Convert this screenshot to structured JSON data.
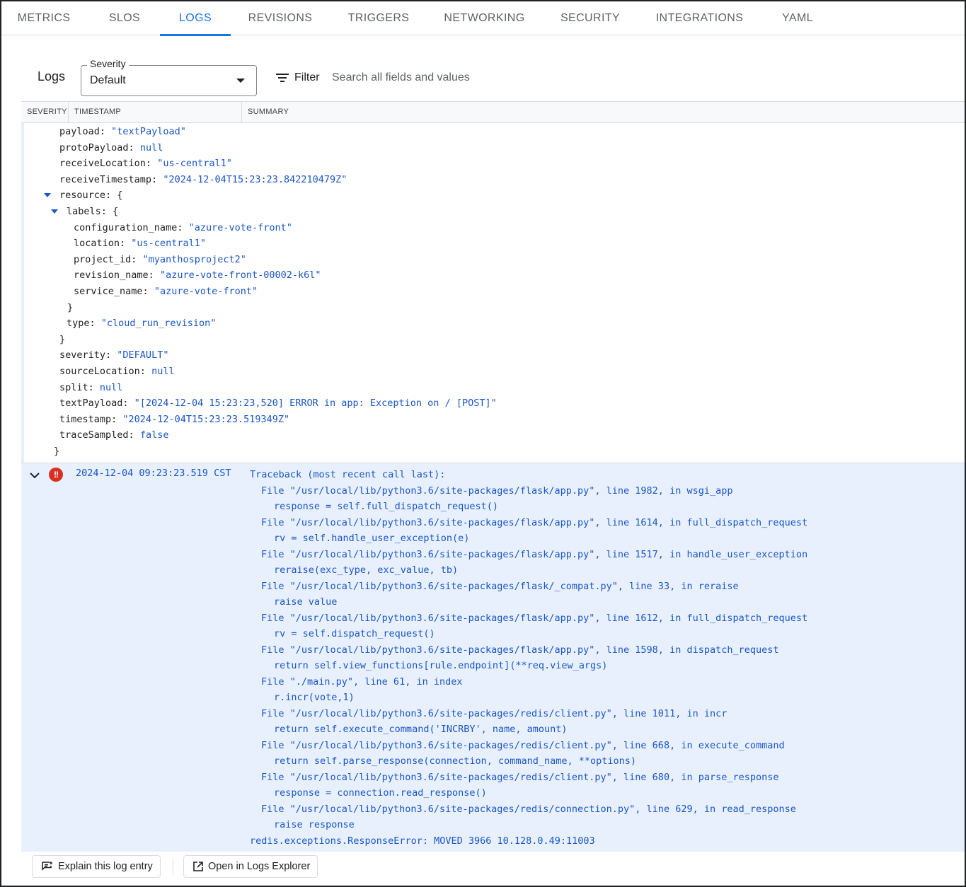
{
  "tabs": [
    {
      "label": "METRICS",
      "active": false
    },
    {
      "label": "SLOS",
      "active": false
    },
    {
      "label": "LOGS",
      "active": true
    },
    {
      "label": "REVISIONS",
      "active": false
    },
    {
      "label": "TRIGGERS",
      "active": false
    },
    {
      "label": "NETWORKING",
      "active": false
    },
    {
      "label": "SECURITY",
      "active": false
    },
    {
      "label": "INTEGRATIONS",
      "active": false
    },
    {
      "label": "YAML",
      "active": false
    }
  ],
  "logs": {
    "title": "Logs",
    "severity_label": "Severity",
    "severity_value": "Default",
    "filter_label": "Filter",
    "search_placeholder": "Search all fields and values"
  },
  "columns": [
    "SEVERITY",
    "TIMESTAMP",
    "SUMMARY"
  ],
  "json_lines": [
    {
      "key": "payload",
      "val": "\"textPayload\"",
      "kind": "str",
      "indent": 0
    },
    {
      "key": "protoPayload",
      "val": "null",
      "kind": "lit",
      "indent": 0
    },
    {
      "key": "receiveLocation",
      "val": "\"us-central1\"",
      "kind": "str",
      "indent": 0
    },
    {
      "key": "receiveTimestamp",
      "val": "\"2024-12-04T15:23:23.842210479Z\"",
      "kind": "str",
      "indent": 0
    },
    {
      "key": "resource",
      "val": "{",
      "kind": "punct",
      "indent": 0,
      "toggle": true
    },
    {
      "key": "labels",
      "val": "{",
      "kind": "punct",
      "indent": 1,
      "toggle": true
    },
    {
      "key": "configuration_name",
      "val": "\"azure-vote-front\"",
      "kind": "str",
      "indent": 2
    },
    {
      "key": "location",
      "val": "\"us-central1\"",
      "kind": "str",
      "indent": 2
    },
    {
      "key": "project_id",
      "val": "\"myanthosproject2\"",
      "kind": "str",
      "indent": 2
    },
    {
      "key": "revision_name",
      "val": "\"azure-vote-front-00002-k6l\"",
      "kind": "str",
      "indent": 2
    },
    {
      "key": "service_name",
      "val": "\"azure-vote-front\"",
      "kind": "str",
      "indent": 2
    },
    {
      "key": "",
      "val": "}",
      "kind": "punct",
      "indent": 1.1
    },
    {
      "key": "type",
      "val": "\"cloud_run_revision\"",
      "kind": "str",
      "indent": 1
    },
    {
      "key": "",
      "val": "}",
      "kind": "punct",
      "indent": 0
    },
    {
      "key": "severity",
      "val": "\"DEFAULT\"",
      "kind": "str",
      "indent": 0
    },
    {
      "key": "sourceLocation",
      "val": "null",
      "kind": "lit",
      "indent": 0
    },
    {
      "key": "split",
      "val": "null",
      "kind": "lit",
      "indent": 0
    },
    {
      "key": "textPayload",
      "val": "\"[2024-12-04 15:23:23,520] ERROR in app: Exception on / [POST]\"",
      "kind": "str",
      "indent": 0
    },
    {
      "key": "timestamp",
      "val": "\"2024-12-04T15:23:23.519349Z\"",
      "kind": "str",
      "indent": 0
    },
    {
      "key": "traceSampled",
      "val": "false",
      "kind": "lit",
      "indent": 0
    },
    {
      "key": "",
      "val": "}",
      "kind": "punct",
      "indent": -0.8
    }
  ],
  "error_entry": {
    "severity_icon": "error-icon",
    "timestamp": "2024-12-04 09:23:23.519 CST",
    "traceback": [
      {
        "text": "Traceback (most recent call last):",
        "indent": 0
      },
      {
        "text": "File \"/usr/local/lib/python3.6/site-packages/flask/app.py\", line 1982, in wsgi_app",
        "indent": 1
      },
      {
        "text": "response = self.full_dispatch_request()",
        "indent": 2
      },
      {
        "text": "File \"/usr/local/lib/python3.6/site-packages/flask/app.py\", line 1614, in full_dispatch_request",
        "indent": 1
      },
      {
        "text": "rv = self.handle_user_exception(e)",
        "indent": 2
      },
      {
        "text": "File \"/usr/local/lib/python3.6/site-packages/flask/app.py\", line 1517, in handle_user_exception",
        "indent": 1
      },
      {
        "text": "reraise(exc_type, exc_value, tb)",
        "indent": 2
      },
      {
        "text": "File \"/usr/local/lib/python3.6/site-packages/flask/_compat.py\", line 33, in reraise",
        "indent": 1
      },
      {
        "text": "raise value",
        "indent": 2
      },
      {
        "text": "File \"/usr/local/lib/python3.6/site-packages/flask/app.py\", line 1612, in full_dispatch_request",
        "indent": 1
      },
      {
        "text": "rv = self.dispatch_request()",
        "indent": 2
      },
      {
        "text": "File \"/usr/local/lib/python3.6/site-packages/flask/app.py\", line 1598, in dispatch_request",
        "indent": 1
      },
      {
        "text": "return self.view_functions[rule.endpoint](**req.view_args)",
        "indent": 2
      },
      {
        "text": "File \"./main.py\", line 61, in index",
        "indent": 1
      },
      {
        "text": "r.incr(vote,1)",
        "indent": 2
      },
      {
        "text": "File \"/usr/local/lib/python3.6/site-packages/redis/client.py\", line 1011, in incr",
        "indent": 1
      },
      {
        "text": "return self.execute_command('INCRBY', name, amount)",
        "indent": 2
      },
      {
        "text": "File \"/usr/local/lib/python3.6/site-packages/redis/client.py\", line 668, in execute_command",
        "indent": 1
      },
      {
        "text": "return self.parse_response(connection, command_name, **options)",
        "indent": 2
      },
      {
        "text": "File \"/usr/local/lib/python3.6/site-packages/redis/client.py\", line 680, in parse_response",
        "indent": 1
      },
      {
        "text": "response = connection.read_response()",
        "indent": 2
      },
      {
        "text": "File \"/usr/local/lib/python3.6/site-packages/redis/connection.py\", line 629, in read_response",
        "indent": 1
      },
      {
        "text": "raise response",
        "indent": 2
      },
      {
        "text": "redis.exceptions.ResponseError: MOVED 3966 10.128.0.49:11003",
        "indent": 0
      }
    ]
  },
  "actions": {
    "explain_label": "Explain this log entry",
    "open_label": "Open in Logs Explorer"
  },
  "colors": {
    "accent": "#1a73e8",
    "value_blue": "#1a56c4",
    "error_red": "#d93025",
    "row_highlight": "#e8f0fe"
  }
}
